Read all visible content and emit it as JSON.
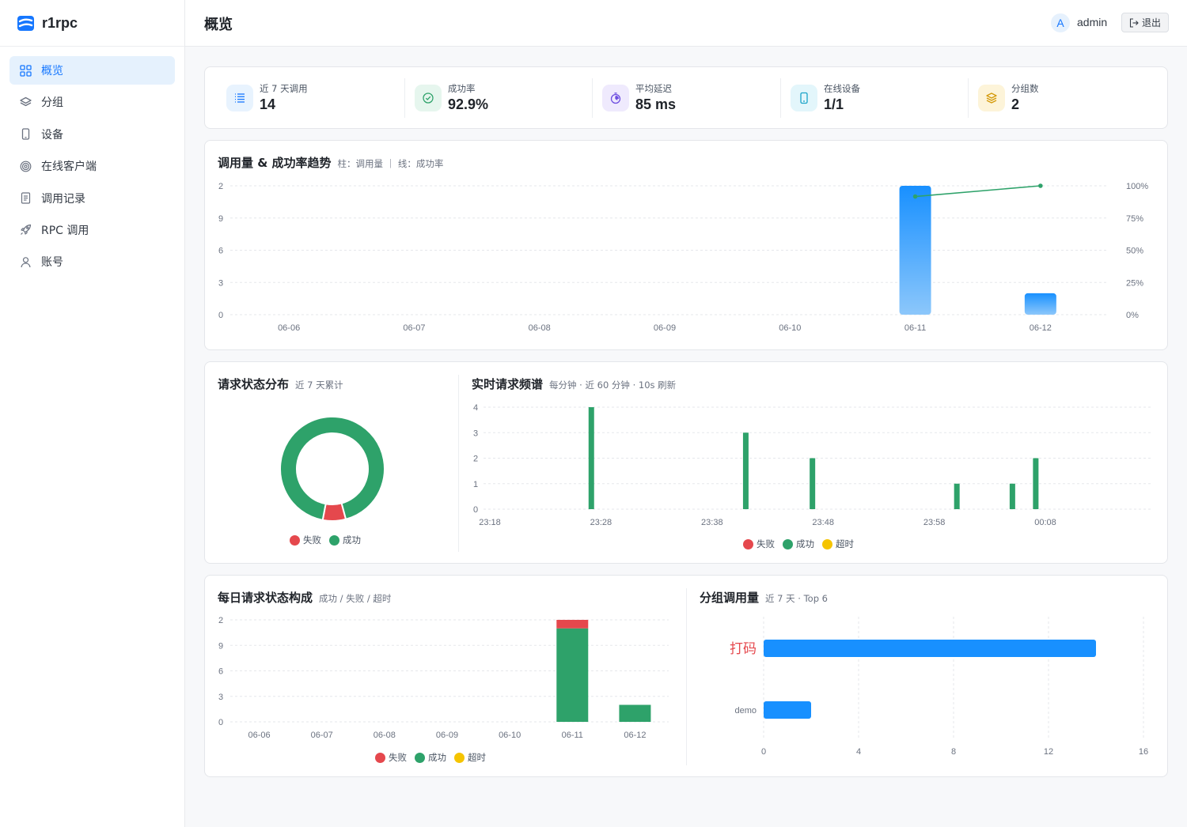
{
  "app": {
    "name": "r1rpc"
  },
  "sidebar": {
    "items": [
      {
        "label": "概览",
        "icon": "grid-icon",
        "active": true
      },
      {
        "label": "分组",
        "icon": "layers-icon"
      },
      {
        "label": "设备",
        "icon": "phone-icon"
      },
      {
        "label": "在线客户端",
        "icon": "target-icon"
      },
      {
        "label": "调用记录",
        "icon": "document-icon"
      },
      {
        "label": "RPC 调用",
        "icon": "rocket-icon"
      },
      {
        "label": "账号",
        "icon": "user-icon"
      }
    ]
  },
  "header": {
    "title": "概览",
    "avatar_letter": "A",
    "username": "admin",
    "logout_label": "退出"
  },
  "stats": [
    {
      "label": "近 7 天调用",
      "value": "14",
      "icon": "list-icon",
      "color": "#1677ff",
      "bg": "#e8f3fe"
    },
    {
      "label": "成功率",
      "value": "92.9%",
      "icon": "check-circle-icon",
      "color": "#2ea26a",
      "bg": "#e6f6ee"
    },
    {
      "label": "平均延迟",
      "value": "85 ms",
      "icon": "stopwatch-icon",
      "color": "#6d4ee0",
      "bg": "#efeafd"
    },
    {
      "label": "在线设备",
      "value": "1/1",
      "icon": "device-icon",
      "color": "#1aa3c8",
      "bg": "#e3f6fb"
    },
    {
      "label": "分组数",
      "value": "2",
      "icon": "stack-icon",
      "color": "#d49a0a",
      "bg": "#fdf4d9"
    }
  ],
  "colors": {
    "fail": "#e5484d",
    "success": "#2ea26a",
    "timeout": "#f5c400",
    "primary": "#1890ff"
  },
  "chart_data": [
    {
      "id": "trend",
      "type": "bar",
      "title": "调用量 & 成功率趋势",
      "subtitle": "柱：调用量 ｜ 线：成功率",
      "categories": [
        "06-06",
        "06-07",
        "06-08",
        "06-09",
        "06-10",
        "06-11",
        "06-12"
      ],
      "y_ticks": [
        "2",
        "9",
        "6",
        "3",
        "0"
      ],
      "y_right_ticks": [
        "100%",
        "75%",
        "50%",
        "25%",
        "0%"
      ],
      "series": [
        {
          "type": "bar",
          "values": [
            0,
            0,
            0,
            0,
            0,
            12,
            2
          ]
        },
        {
          "type": "line",
          "values": [
            null,
            null,
            null,
            null,
            null,
            91.7,
            100
          ]
        }
      ],
      "ylim": [
        0,
        12
      ]
    },
    {
      "id": "status-donut",
      "type": "pie",
      "title": "请求状态分布",
      "subtitle": "近 7 天累计",
      "slices": [
        {
          "name": "失败",
          "value": 1
        },
        {
          "name": "成功",
          "value": 13
        }
      ]
    },
    {
      "id": "realtime",
      "type": "bar",
      "title": "实时请求频谱",
      "subtitle": "每分钟 · 近 60 分钟 · 10s 刷新",
      "x_ticks": [
        "23:18",
        "23:28",
        "23:38",
        "23:48",
        "23:58",
        "00:08"
      ],
      "y_ticks": [
        "4",
        "3",
        "2",
        "1",
        "0"
      ],
      "ylim": [
        0,
        4
      ],
      "x_range_minutes": [
        0,
        50
      ],
      "points": [
        {
          "minute": 9.1,
          "value": 4
        },
        {
          "minute": 23,
          "value": 3
        },
        {
          "minute": 29,
          "value": 2
        },
        {
          "minute": 42,
          "value": 1
        },
        {
          "minute": 47,
          "value": 1
        },
        {
          "minute": 49.1,
          "value": 2
        }
      ],
      "legend": [
        "失败",
        "成功",
        "超时"
      ]
    },
    {
      "id": "daily-stack",
      "type": "bar",
      "title": "每日请求状态构成",
      "subtitle": "成功 / 失败 / 超时",
      "categories": [
        "06-06",
        "06-07",
        "06-08",
        "06-09",
        "06-10",
        "06-11",
        "06-12"
      ],
      "y_ticks": [
        "2",
        "9",
        "6",
        "3",
        "0"
      ],
      "ylim": [
        0,
        12
      ],
      "series": [
        {
          "name": "成功",
          "values": [
            0,
            0,
            0,
            0,
            0,
            11,
            2
          ]
        },
        {
          "name": "失败",
          "values": [
            0,
            0,
            0,
            0,
            0,
            1,
            0
          ]
        },
        {
          "name": "超时",
          "values": [
            0,
            0,
            0,
            0,
            0,
            0,
            0
          ]
        }
      ],
      "legend": [
        "失败",
        "成功",
        "超时"
      ]
    },
    {
      "id": "group-usage",
      "type": "bar",
      "orientation": "horizontal",
      "title": "分组调用量",
      "subtitle": "近 7 天 · Top 6",
      "categories": [
        "打码",
        "demo"
      ],
      "values": [
        14,
        2
      ],
      "x_ticks": [
        "0",
        "4",
        "8",
        "12",
        "16"
      ],
      "xlim": [
        0,
        16
      ]
    }
  ]
}
